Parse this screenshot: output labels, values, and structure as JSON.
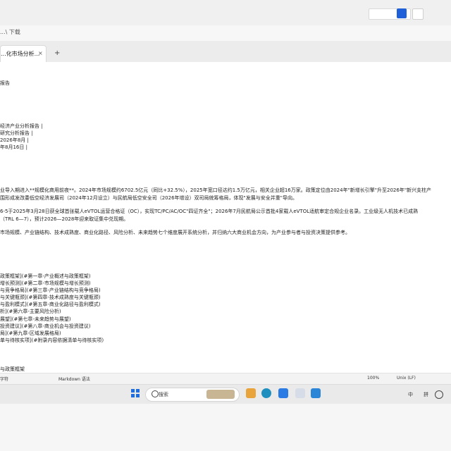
{
  "address": "...\\ 下载",
  "tab": {
    "label": "...化市场分析...",
    "close": "×",
    "add": "+"
  },
  "doc_lines": [
    "报告",
    "经济产业分析报告 |",
    "研究分析报告 |",
    "2026年8月 |",
    "年8月16日 |",
    "业导入期进入**规模化商用前夜**。2024年市场规模约6702.5亿元（同比+32.5%），2025年宽口径达约1.5万亿元，相关企业超16万家。政策定位由2024年\"新增长引擎\"升至2026年\"新兴支柱产",
    "围形成发改委低空经济发展司（2024年12月设立）与民航局低空安全司（2026年增设）双司局统筹格局，体现\"发展与安全并重\"导向。",
    "6-5于2025年3月28日获全球首张载人eVTOL运营合格证（OC），实现TC/PC/AC/OC\"四证齐全\"；2026年7月民航局公示首批4家载人eVTOL适航审定合规企业名录。工业级无人机技术已成熟",
    "（TRL 6—7），预计2026—2028年迎来取证集中兑现期。",
    "市场规模、产业链结构、技术成熟度、商业化路径、风险分析、未来趋势七个维度展开系统分析，并归纳六大商业机会方向，为产业参与者与投资决策提供参考。"
  ],
  "toc": [
    "政策框架](#第一章-产业概述与政策框架)",
    "增长预测](#第二章-市场规模与增长预测)",
    "与竞争格局](#第三章-产业链结构与竞争格局)",
    "与关键瓶颈](#第四章-技术成熟度与关键瓶颈)",
    "与盈利模式](#第五章-商业化路径与盈利模式)",
    "析](#第六章-主要风险分析)",
    "展望](#第七章-未来趋势与展望)",
    "投资建议](#第八章-商业机会与投资建议)",
    "局](#第九章-区域发展格局)",
    "单与待核实项](#附录内容依据清单与待核实项)"
  ],
  "section_heading": "与政策框架",
  "status": {
    "chars": "字符",
    "mode": "Markdown 语法",
    "zoom": "100%",
    "eol": "Unix (LF)"
  },
  "taskbar": {
    "search_label": "搜索",
    "tray_lang": "中",
    "tray_pinyin": "拼"
  }
}
